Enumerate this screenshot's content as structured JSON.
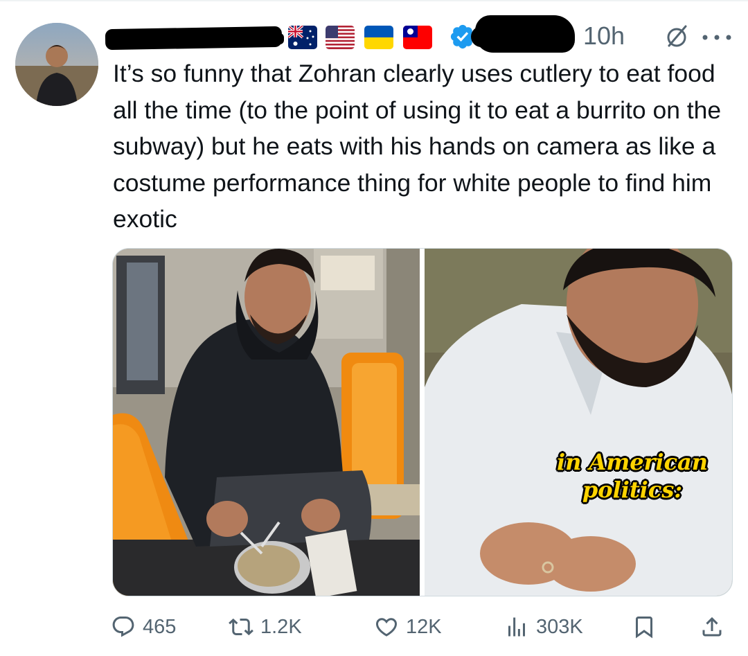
{
  "tweet": {
    "time": "10h",
    "text": "It’s so funny that Zohran clearly uses cutlery to eat food all the time (to the point of using it to eat a burrito on the subway) but he eats with his hands on camera as like a costume performance thing for white people to find him exotic",
    "media_caption": [
      "in American",
      "politics:"
    ],
    "flags": [
      "australia-flag",
      "usa-flag",
      "ukraine-flag",
      "taiwan-flag"
    ]
  },
  "actions": {
    "replies": "465",
    "reposts": "1.2K",
    "likes": "12K",
    "views": "303K"
  },
  "colors": {
    "text": "#0f1419",
    "secondary": "#536471",
    "verified": "#1d9bf0",
    "caption": "#ffd400",
    "subway_seat": "#f08a10"
  }
}
